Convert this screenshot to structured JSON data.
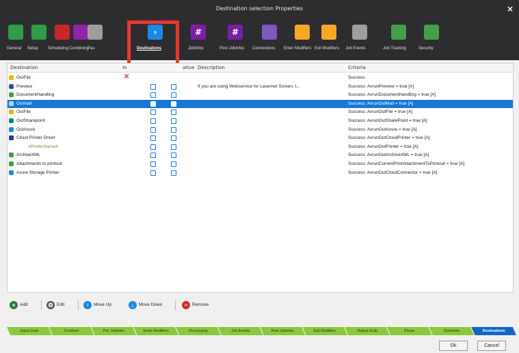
{
  "window": {
    "title": "Destination selection Properties",
    "close_symbol": "×"
  },
  "ribbon": {
    "items": [
      {
        "label": "General",
        "icon": "toggle-icon",
        "color": "#2e9d45"
      },
      {
        "label": "Setup",
        "icon": "gear-icon",
        "color": "#2e9d45"
      },
      {
        "label": "Scheduling",
        "icon": "calendar-icon",
        "color": "#c62828"
      },
      {
        "label": "Combining",
        "icon": "merge-icon",
        "color": "#8e24aa"
      },
      {
        "label": "Pau",
        "icon": "pause-icon",
        "color": "#9e9e9e"
      },
      {
        "label": "Destinations",
        "icon": "arrow-right-icon",
        "color": "#1e88e5",
        "active": true
      },
      {
        "label": "JobInfos",
        "icon": "hash-icon",
        "color": "#7b1fa2"
      },
      {
        "label": "Post JobInfos",
        "icon": "hash-icon",
        "color": "#7b1fa2"
      },
      {
        "label": "Connections",
        "icon": "list-icon",
        "color": "#7e57c2"
      },
      {
        "label": "Enter Modifiers",
        "icon": "enter-modifier-icon",
        "color": "#f9a825"
      },
      {
        "label": "Exit Modifiers",
        "icon": "exit-modifier-icon",
        "color": "#f9a825"
      },
      {
        "label": "Job Events",
        "icon": "events-icon",
        "color": "#9e9e9e"
      },
      {
        "label": "Job Tracking",
        "icon": "tracking-icon",
        "color": "#43a047"
      },
      {
        "label": "Security",
        "icon": "shield-icon",
        "color": "#43a047"
      }
    ]
  },
  "table": {
    "headers": {
      "destination": "Destination",
      "col2": "In",
      "col3": "ative",
      "description": "Description",
      "criteria": "Criteria"
    },
    "rows": [
      {
        "name": "OutFile",
        "icon": "folder-icon",
        "icon_color": "#f5b301",
        "x_mark": "✕",
        "c1": false,
        "c2": false,
        "description": "",
        "criteria": "Success"
      },
      {
        "name": "Preview",
        "icon": "preview-icon",
        "icon_color": "#3949ab",
        "c1": true,
        "c2": true,
        "description": "If you are using Webservice for Lasernet Screen, t...",
        "criteria": "Success: AvrunPreview = true [A]"
      },
      {
        "name": "DocumentHandling",
        "icon": "globe-icon",
        "icon_color": "#43a047",
        "c1": true,
        "c2": true,
        "description": "",
        "criteria": "Success: AvrunDocumentHandling = true [A]"
      },
      {
        "name": "Outmail",
        "icon": "mail-icon",
        "icon_color": "#b3d4ff",
        "c1": true,
        "c2": true,
        "description": "",
        "criteria": "Success: AvrunOutMail = true [A]",
        "selected": true
      },
      {
        "name": "OutFile",
        "icon": "folder-icon",
        "icon_color": "#f5b301",
        "c1": true,
        "c2": true,
        "description": "",
        "criteria": "Success: AvrunOutFile = true [A]"
      },
      {
        "name": "OutSharepoint",
        "icon": "sharepoint-icon",
        "icon_color": "#00897b",
        "c1": true,
        "c2": true,
        "description": "",
        "criteria": "Success: AvrunOutSharePoint = true [A]"
      },
      {
        "name": "OutAzure",
        "icon": "azure-icon",
        "icon_color": "#1e88e5",
        "c1": true,
        "c2": true,
        "description": "",
        "criteria": "Success: AvrunOutAzure = true [A]"
      },
      {
        "name": "Cloud Printer Driver",
        "icon": "printer-icon",
        "icon_color": "#283593",
        "c1": true,
        "c2": true,
        "description": "",
        "criteria": "Success: AvrunOutCloudPrinter = true [A]"
      },
      {
        "name": "#PrinterName#",
        "icon": "",
        "icon_color": "",
        "italic": true,
        "c1": true,
        "c2": true,
        "description": "",
        "criteria": "Success: AvrunOutPrinter = true [A]"
      },
      {
        "name": "ArchiveXML",
        "icon": "globe-icon",
        "icon_color": "#43a047",
        "c1": true,
        "c2": true,
        "description": "",
        "criteria": "Success: AvrunOutArchiveXML = true [A]"
      },
      {
        "name": "Attachments to printout",
        "icon": "globe-icon",
        "icon_color": "#43a047",
        "c1": true,
        "c2": true,
        "description": "",
        "criteria": "Success: AvrunCurrentPrintAttachmentToPrintout = true [A]"
      },
      {
        "name": "Azure Storage Printer",
        "icon": "azure-icon",
        "icon_color": "#1e88e5",
        "c1": true,
        "c2": true,
        "description": "",
        "criteria": "Success: AvrunOutCloudConnector = true [A]"
      }
    ]
  },
  "toolbar": {
    "add": {
      "label": "Add",
      "symbol": "+",
      "color": "#2e7d32"
    },
    "edit": {
      "label": "Edit",
      "symbol": "⚙",
      "color": "#455a64"
    },
    "move_up": {
      "label": "Move Up",
      "symbol": "↑",
      "color": "#1e88e5"
    },
    "move_down": {
      "label": "Move Down",
      "symbol": "↓",
      "color": "#1e88e5"
    },
    "remove": {
      "label": "Remove",
      "symbol": "−",
      "color": "#d32f2f"
    }
  },
  "pipeline": {
    "steps": [
      "Input Grab",
      "Combine",
      "Pre JobInfos",
      "Enter Modifiers",
      "Processing",
      "Job Events",
      "Post JobInfos",
      "Exit Modifiers",
      "Output Grab",
      "Pause",
      "Schedule",
      "Destinations"
    ],
    "active": "Destinations"
  },
  "dialog": {
    "ok_label": "Ok",
    "cancel_label": "Cancel"
  },
  "colors": {
    "selection": "#1976d2",
    "highlight_box": "#e8372f",
    "pipeline": "#8dc63f",
    "pipeline_active": "#1565c0"
  }
}
